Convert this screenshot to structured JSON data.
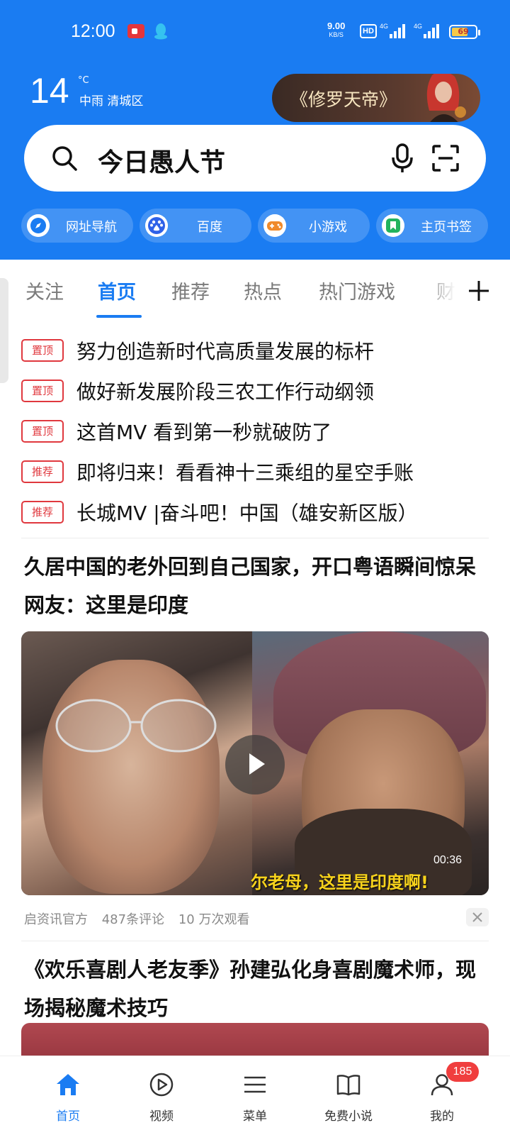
{
  "status_bar": {
    "time": "12:00",
    "net_speed": "9.00",
    "net_speed_unit": "KB/S",
    "hd_label": "HD",
    "signal1_label": "4G",
    "signal2_label": "4G",
    "battery": "69",
    "battery_level": 0.69
  },
  "weather": {
    "temperature": "14",
    "unit": "°C",
    "description": "中雨 清城区"
  },
  "promo": {
    "label": "《修罗天帝》"
  },
  "search": {
    "text": "今日愚人节"
  },
  "shortcuts": [
    {
      "label": "网址导航",
      "icon": "compass-icon",
      "color": "#1a7cf2"
    },
    {
      "label": "百度",
      "icon": "baidu-paw-icon",
      "color": "#2f62e8"
    },
    {
      "label": "小游戏",
      "icon": "gamepad-icon",
      "color": "#f08a2a"
    },
    {
      "label": "主页书签",
      "icon": "bookmark-icon",
      "color": "#22b35e"
    }
  ],
  "tabs": [
    {
      "label": "关注"
    },
    {
      "label": "首页",
      "active": true
    },
    {
      "label": "推荐"
    },
    {
      "label": "热点"
    },
    {
      "label": "热门游戏"
    },
    {
      "label": "财"
    }
  ],
  "headlines": [
    {
      "tag": "置顶",
      "text": "努力创造新时代高质量发展的标杆"
    },
    {
      "tag": "置顶",
      "text": "做好新发展阶段三农工作行动纲领"
    },
    {
      "tag": "置顶",
      "text": "这首MV 看到第一秒就破防了"
    },
    {
      "tag": "推荐",
      "text": "即将归来！看看神十三乘组的星空手账"
    },
    {
      "tag": "推荐",
      "text": "长城MV |奋斗吧！中国（雄安新区版）"
    }
  ],
  "article1": {
    "title": "久居中国的老外回到自己国家，开口粤语瞬间惊呆网友：这里是印度",
    "duration": "00:36",
    "subtitle": "尔老母，这里是印度啊!",
    "source": "启资讯官方",
    "comments": "487条评论",
    "views": "10 万次观看"
  },
  "article2": {
    "title": "《欢乐喜剧人老友季》孙建弘化身喜剧魔术师，现场揭秘魔术技巧"
  },
  "bottom_nav": [
    {
      "label": "首页",
      "icon": "home-icon",
      "active": true
    },
    {
      "label": "视频",
      "icon": "play-circle-icon"
    },
    {
      "label": "菜单",
      "icon": "menu-icon"
    },
    {
      "label": "免费小说",
      "icon": "book-icon"
    },
    {
      "label": "我的",
      "icon": "user-icon",
      "badge": "185"
    }
  ],
  "colors": {
    "accent": "#1a7cf2",
    "tag_red": "#e0383e",
    "badge_red": "#f03e3e"
  }
}
